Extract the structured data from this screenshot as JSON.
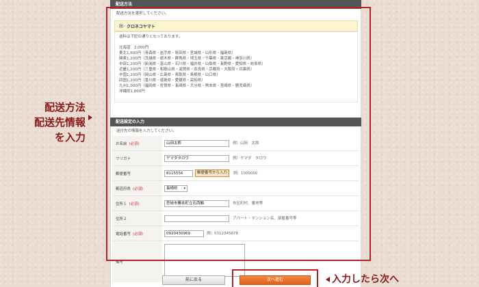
{
  "shipping_method": {
    "header": "配送方法",
    "instruction": "配送方法を選択してください。",
    "option_label": "クロネコヤマト",
    "rate_intro": "送料は下記の通りとなっております。",
    "rates": [
      "北海道　2,000円",
      "東北1,600円（青森県・岩手県・秋田県・宮城県・山形県・福島県）",
      "関東1,200円（茨城県・栃木県・群馬県・埼玉県・千葉県・東京都・神奈川県）",
      "中部1,200円（新潟県・富山県・石川県・福井県・山梨県・長野県・愛知県・岐阜県）",
      "近畿1,200円（三重県・和歌山県・滋賀県・奈良県・京都府・大阪府・兵庫県）",
      "中国1,200円（岡山県・広島県・鳥取県・島根県・山口県）",
      "四国1,200円（香川県・徳島県・愛媛県・高知県）",
      "九州1,000円（福岡県・佐賀県・長崎県・大分県・熊本県・宮崎県・鹿児島県）",
      "沖縄県1,800円"
    ]
  },
  "delivery_form": {
    "header": "配送設定の入力",
    "instruction": "送付先の情報を入力してください。",
    "required_mark": "(必須)",
    "fields": {
      "name": {
        "label": "お名前",
        "value": "山田太郎",
        "hint": "例）山田　太郎"
      },
      "furigana": {
        "label": "フリガナ",
        "value": "ヤマダタロウ",
        "hint": "例）ヤマダ　タロウ"
      },
      "zip": {
        "label": "郵便番号",
        "value": "8115556",
        "button": "郵便番号から入力",
        "hint": "例）1000000"
      },
      "prefecture": {
        "label": "都道府県",
        "value": "長崎県"
      },
      "address1": {
        "label": "住所１",
        "value": "壱岐市勝本町立石西触",
        "hint": "市区町村、番地等"
      },
      "address2": {
        "label": "住所２",
        "value": "",
        "hint": "アパート・マンション名、部屋番号等"
      },
      "phone": {
        "label": "電話番号",
        "value": "0920430969",
        "hint": "例）0312345678"
      },
      "note": {
        "label": "備考",
        "value": ""
      }
    }
  },
  "buttons": {
    "back": "前に戻る",
    "next": "次へ進む"
  },
  "annotations": {
    "side_lines": [
      "配送方法",
      "配送先情報",
      "を入力"
    ],
    "next_note": "入力したら次へ",
    "color": "#8b1a1a"
  }
}
